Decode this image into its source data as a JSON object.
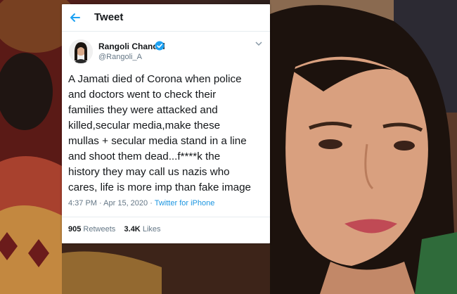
{
  "header": {
    "back_icon": "back-arrow-icon",
    "title": "Tweet"
  },
  "author": {
    "name": "Rangoli Chandel",
    "handle": "@Rangoli_A",
    "verified_icon": "verified-badge-icon",
    "menu_icon": "chevron-down-icon"
  },
  "tweet": {
    "text": "A Jamati died of Corona when police\nand doctors went to check their\nfamilies they were attacked and\nkilled,secular media,make these\nmullas + secular media stand in a line\nand shoot them dead...f****k the\nhistory they may call us nazis who\ncares, life is more imp than fake image",
    "time": "4:37 PM",
    "separator": "·",
    "date": "Apr 15, 2020",
    "source": "Twitter for iPhone",
    "retweets_count": "905",
    "retweets_label": "Retweets",
    "likes_count": "3.4K",
    "likes_label": "Likes"
  },
  "colors": {
    "accent": "#1da1f2",
    "text": "#14171a",
    "muted": "#657786"
  }
}
